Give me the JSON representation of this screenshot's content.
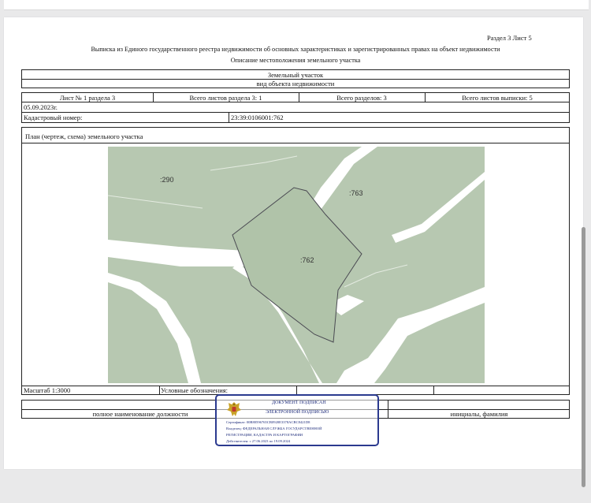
{
  "header": {
    "section_sheet": "Раздел 3   Лист 5",
    "title": "Выписка из Единого государственного реестра недвижимости об основных характеристиках и зарегистрированных правах на объект недвижимости",
    "subtitle": "Описание местоположения земельного участка"
  },
  "object": {
    "name": "Земельный участок",
    "type_caption": "вид объекта недвижимости"
  },
  "sheet_info": {
    "sheet": "Лист № 1 раздела 3",
    "total_sheets_section": "Всего листов раздела 3: 1",
    "total_sections": "Всего разделов: 3",
    "total_sheets_extract": "Всего листов выписки: 5"
  },
  "date": "05.09.2023г.",
  "cadastral": {
    "label": "Кадастровый номер:",
    "value": "23:39:0106001:762"
  },
  "plan_title": "План (чертеж, схема) земельного участка",
  "map_labels": {
    "parcel_290": ":290",
    "parcel_763": ":763",
    "parcel_762": ":762"
  },
  "footer": {
    "scale": "Масштаб 1:3000",
    "legend": "Условные обозначения:",
    "position_caption": "полное наименование должности",
    "initials_caption": "инициалы, фамилия"
  },
  "signature": {
    "line1": "ДОКУМЕНТ ПОДПИСАН",
    "line2": "ЭЛЕКТРОННОЙ ПОДПИСЬЮ",
    "certificate": "Сертификат: 00B80596765CB0920E3378ACBC8421D8",
    "owner": "Владелец: ФЕДЕРАЛЬНАЯ СЛУЖБА ГОСУДАРСТВЕННОЙ",
    "owner2": "РЕГИСТРАЦИИ, КАДАСТРА И КАРТОГРАФИИ",
    "validity": "Действителен: с 27.06.2023 по 19.09.2024"
  },
  "colors": {
    "map_green": "#b7c8b1",
    "map_road": "#ffffff",
    "parcel_fill": "#b0c3a9",
    "parcel_border": "#4a4a52",
    "stamp_blue": "#2b3a8f"
  }
}
